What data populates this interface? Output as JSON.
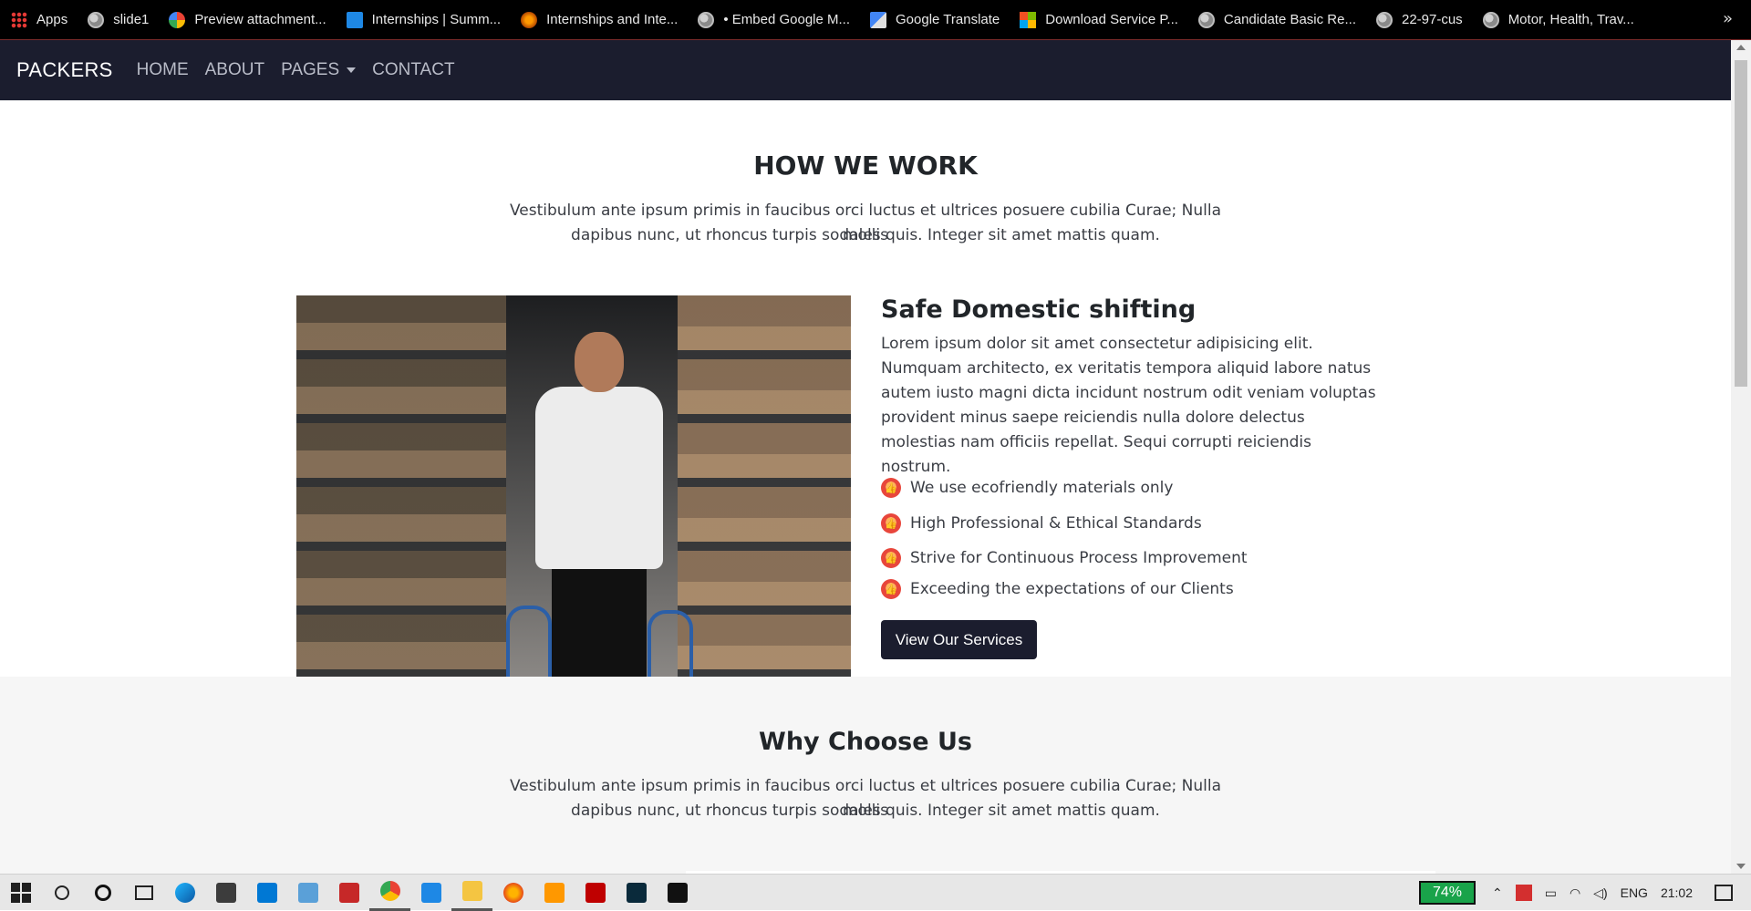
{
  "bookmarks": {
    "items": [
      {
        "label": "Apps",
        "icon": "apps-grid-icon"
      },
      {
        "label": "slide1",
        "icon": "globe-icon"
      },
      {
        "label": "Preview attachment...",
        "icon": "google-icon"
      },
      {
        "label": "Internships | Summ...",
        "icon": "internshala-icon"
      },
      {
        "label": "Internships and Inte...",
        "icon": "flame-icon"
      },
      {
        "label": "• Embed Google M...",
        "icon": "globe-icon"
      },
      {
        "label": "Google Translate",
        "icon": "translate-icon"
      },
      {
        "label": "Download Service P...",
        "icon": "microsoft-icon"
      },
      {
        "label": "Candidate Basic Re...",
        "icon": "globe-icon"
      },
      {
        "label": "22-97-cus",
        "icon": "globe-icon"
      },
      {
        "label": "Motor, Health, Trav...",
        "icon": "globe-icon"
      }
    ],
    "more": "»"
  },
  "navbar": {
    "brand": "PACKERS",
    "links": [
      "HOME",
      "ABOUT",
      "PAGES",
      "CONTACT"
    ]
  },
  "how": {
    "title": "HOW WE WORK",
    "lead_line1": "Vestibulum ante ipsum primis in faucibus orci luctus et ultrices posuere cubilia Curae; Nulla mollis",
    "lead_line2": "dapibus nunc, ut rhoncus turpis sodales quis. Integer sit amet mattis quam.",
    "subtitle": "Safe Domestic shifting",
    "paragraph": "Lorem ipsum dolor sit amet consectetur adipisicing elit. Numquam architecto, ex veritatis tempora aliquid labore natus autem iusto magni dicta incidunt nostrum odit veniam voluptas provident minus saepe reiciendis nulla dolore delectus molestias nam officiis repellat. Sequi corrupti reiciendis nostrum.",
    "features": [
      "We use ecofriendly materials only",
      "High Professional & Ethical Standards",
      "Strive for Continuous Process Improvement",
      "Exceeding the expectations of our Clients"
    ],
    "button": "View Our Services"
  },
  "why": {
    "title": "Why Choose Us",
    "lead_line1": "Vestibulum ante ipsum primis in faucibus orci luctus et ultrices posuere cubilia Curae; Nulla mollis",
    "lead_line2": "dapibus nunc, ut rhoncus turpis sodales quis. Integer sit amet mattis quam."
  },
  "taskbar": {
    "battery": "74%",
    "language": "ENG",
    "time": "21:02"
  },
  "colors": {
    "navbar_bg": "#1b1d2e",
    "button_bg": "#1b1d2e",
    "section_alt_bg": "#f6f6f6",
    "battery_green": "#19a34a"
  }
}
